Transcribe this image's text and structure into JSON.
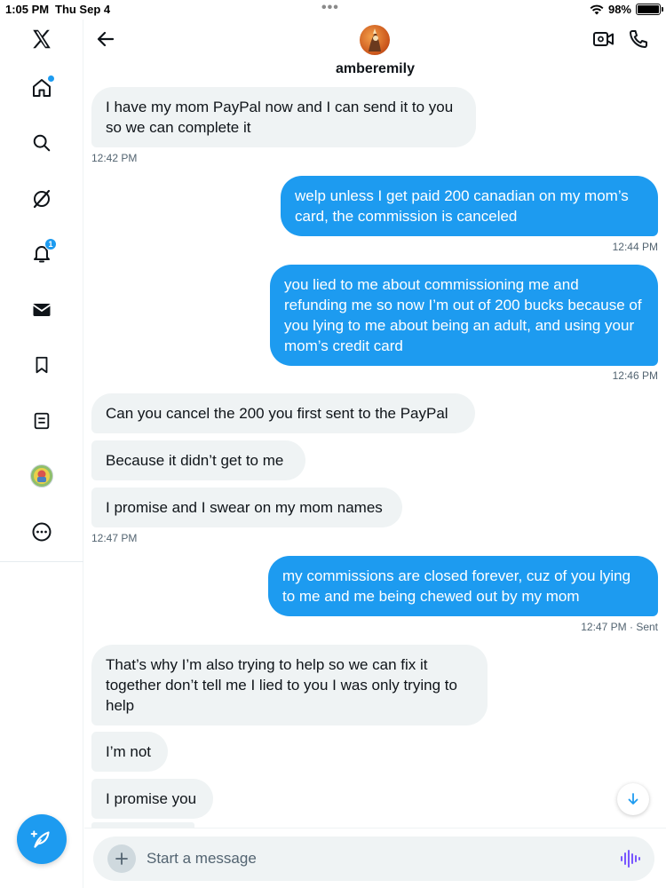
{
  "status": {
    "time": "1:05 PM",
    "date": "Thu Sep 4",
    "battery": "98%",
    "battery_level": 0.98
  },
  "sidebar": {
    "notification_count": "1"
  },
  "header": {
    "username": "amberemily"
  },
  "messages": [
    {
      "dir": "in",
      "text": "I have my mom PayPal now and I can send it to you so we can complete it"
    },
    {
      "dir": "out",
      "text": "welp unless I get paid 200 canadian on my mom’s card, the commission is canceled"
    },
    {
      "dir": "out",
      "text": "you lied to me about commissioning me and refunding me so now I’m out of 200 bucks because of you lying to me about being an adult, and using your mom’s credit card"
    },
    {
      "dir": "in",
      "text": "Can you cancel the 200 you first sent to the PayPal"
    },
    {
      "dir": "in",
      "text": "Because it didn’t get to me"
    },
    {
      "dir": "in",
      "text": "I promise and I swear on my mom names"
    },
    {
      "dir": "out",
      "text": "my commissions are closed forever, cuz of you lying to me and me being chewed out by my mom"
    },
    {
      "dir": "in",
      "text": "That’s why I’m also trying to help so we can fix it together don’t tell me I lied to you I was only trying to help"
    },
    {
      "dir": "in",
      "text": "I’m not"
    },
    {
      "dir": "in",
      "text": "I promise you"
    }
  ],
  "timestamps": {
    "t1": "12:42 PM",
    "t2": "12:44 PM",
    "t3": "12:46 PM",
    "t4": "12:47 PM",
    "t5": "12:47 PM",
    "t5_status": "Sent"
  },
  "composer": {
    "placeholder": "Start a message"
  },
  "colors": {
    "accent": "#1d9bf0",
    "incoming_bubble": "#eff3f4",
    "timestamp": "#536471"
  }
}
